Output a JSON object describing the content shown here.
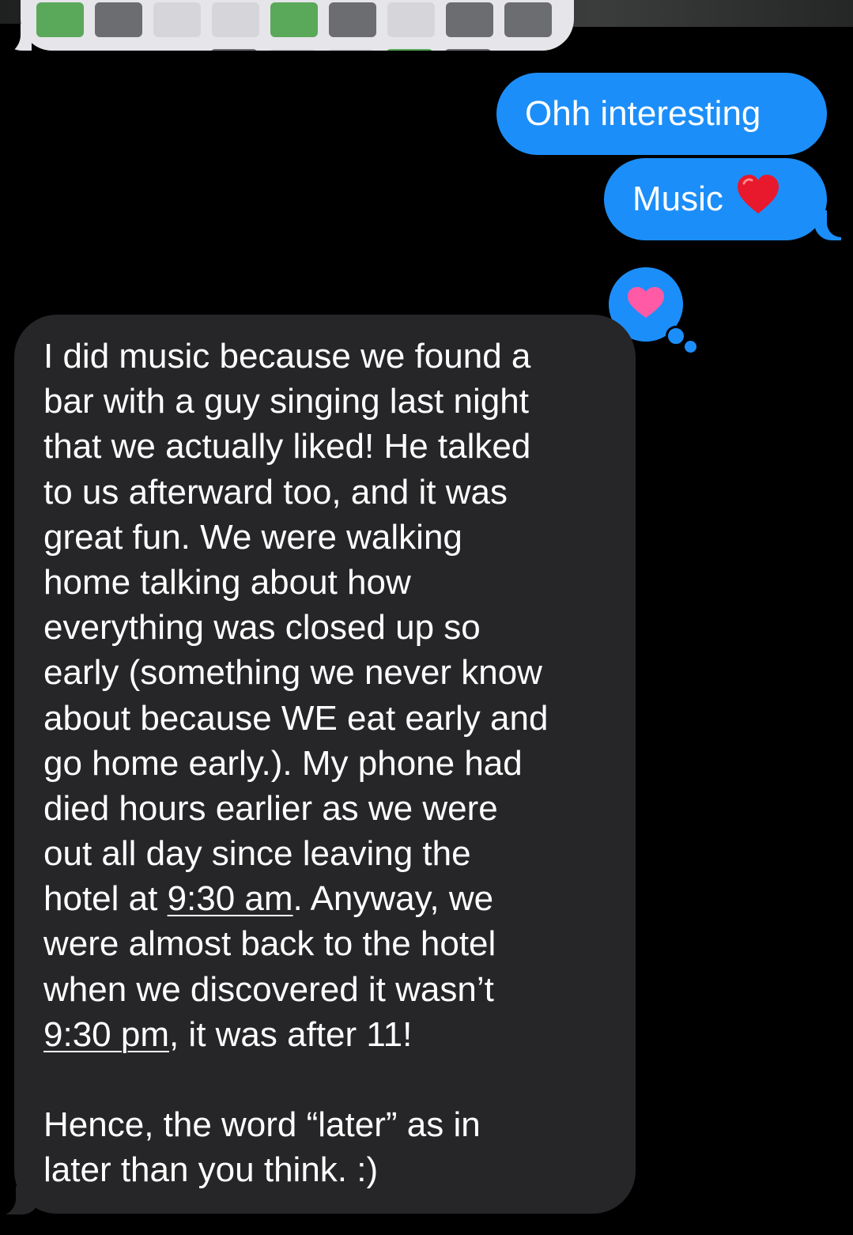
{
  "colors": {
    "outgoing_bubble": "#1c8ef9",
    "incoming_bubble": "#262628",
    "background": "#000000",
    "tapback_heart": "#ff5aa5",
    "emoji_heart": "#e8192c"
  },
  "previous_message": {
    "tile_row_1": [
      "green",
      "dark",
      "light",
      "light",
      "green",
      "dark",
      "light",
      "dark",
      "dark"
    ],
    "tile_row_2": [
      "dark",
      "light",
      "light",
      "green",
      "dark"
    ]
  },
  "messages": {
    "outgoing_1": {
      "text": "Ohh interesting"
    },
    "outgoing_2": {
      "text": "Music",
      "emoji": "red-heart-emoji"
    },
    "tapback": {
      "icon": "heart-icon"
    },
    "incoming": {
      "lines": [
        "I did music because we found a",
        "bar with a guy singing last night",
        "that we actually liked!  He talked",
        "to us afterward too, and it was",
        "great fun. We were walking",
        "home talking about how",
        "everything was closed up so",
        "early (something we never know",
        "about because WE eat early and",
        "go home early.). My phone had",
        "died hours earlier as we were",
        "out all day since leaving the"
      ],
      "line_13_pre": "hotel at ",
      "time_1": "9:30 am",
      "line_13_post": ". Anyway, we",
      "line_14": "were almost back to the hotel",
      "line_15": "when we discovered it wasn’t",
      "time_2": "9:30 pm",
      "line_16_post": ", it was after 11!",
      "line_17": "Hence, the word “later” as in",
      "line_18": "later than you think. :)"
    }
  }
}
